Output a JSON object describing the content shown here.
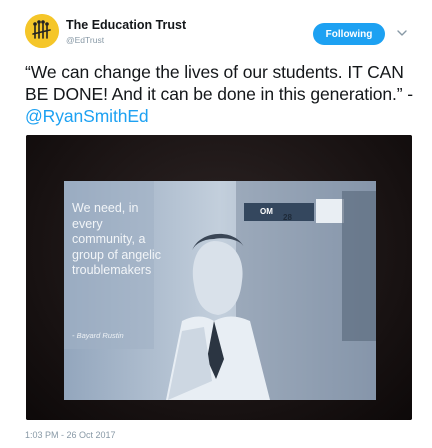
{
  "account": {
    "name": "The Education Trust",
    "handle": "@EdTrust",
    "avatar_icon": "education-trust-logo-icon",
    "avatar_color": "#f5c629"
  },
  "follow_button": {
    "label": "Following",
    "color": "#1da1f2"
  },
  "menu": {
    "icon": "chevron-down-icon"
  },
  "tweet": {
    "text": "“We can change the lives of our students. IT CAN BE DONE! And it can be done in this generation.” - ",
    "mention": "@RyanSmithEd"
  },
  "photo": {
    "quote": "We need, in every community, a group of angelic troublemakers",
    "attribution": "- Bayard Rustin",
    "sign_text": "OM",
    "sign_number": "28"
  },
  "timestamp": "1:03 PM - 26 Oct 2017"
}
